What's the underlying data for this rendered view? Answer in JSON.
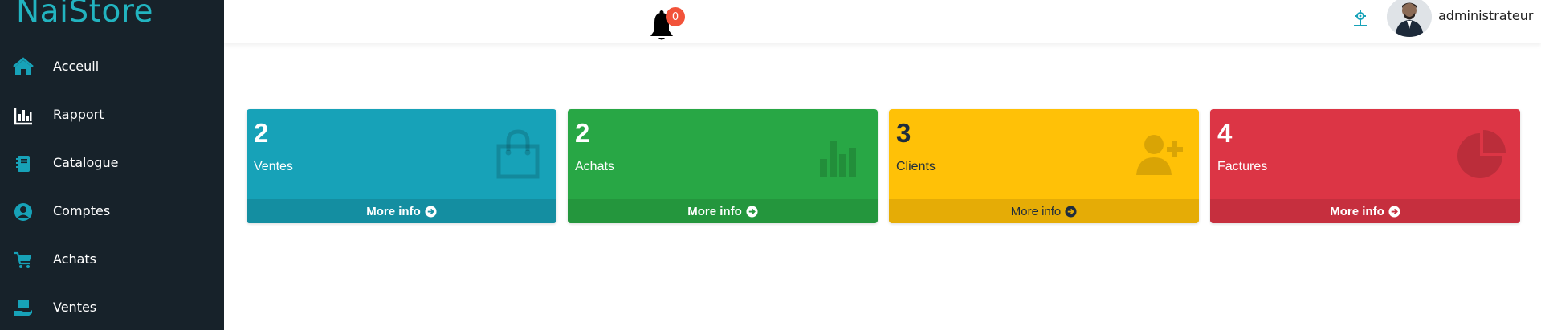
{
  "brand": "NaiStore",
  "sidebar": {
    "items": [
      {
        "label": "Acceuil",
        "icon": "home-icon"
      },
      {
        "label": "Rapport",
        "icon": "bar-chart-icon"
      },
      {
        "label": "Catalogue",
        "icon": "book-icon"
      },
      {
        "label": "Comptes",
        "icon": "user-circle-icon"
      },
      {
        "label": "Achats",
        "icon": "cart-icon"
      },
      {
        "label": "Ventes",
        "icon": "hand-box-icon"
      }
    ]
  },
  "topbar": {
    "notification_count": "0",
    "username": "administrateur"
  },
  "cards": [
    {
      "value": "2",
      "label": "Ventes",
      "more": "More info",
      "color": "#17a2b8",
      "footer_color": "#148ea1",
      "icon": "shopping-bag-icon"
    },
    {
      "value": "2",
      "label": "Achats",
      "more": "More info",
      "color": "#28a745",
      "footer_color": "#24963d",
      "icon": "bar-chart-icon"
    },
    {
      "value": "3",
      "label": "Clients",
      "more": "More info",
      "color": "#ffc107",
      "footer_color": "#e5ac06",
      "icon": "user-plus-icon"
    },
    {
      "value": "4",
      "label": "Factures",
      "more": "More info",
      "color": "#dc3545",
      "footer_color": "#c62f3e",
      "icon": "pie-chart-icon"
    }
  ],
  "colors": {
    "sidebar_bg": "#17222a",
    "brand": "#22b4c0",
    "icon_accent": "#17a2b8",
    "badge": "#f2533a"
  }
}
